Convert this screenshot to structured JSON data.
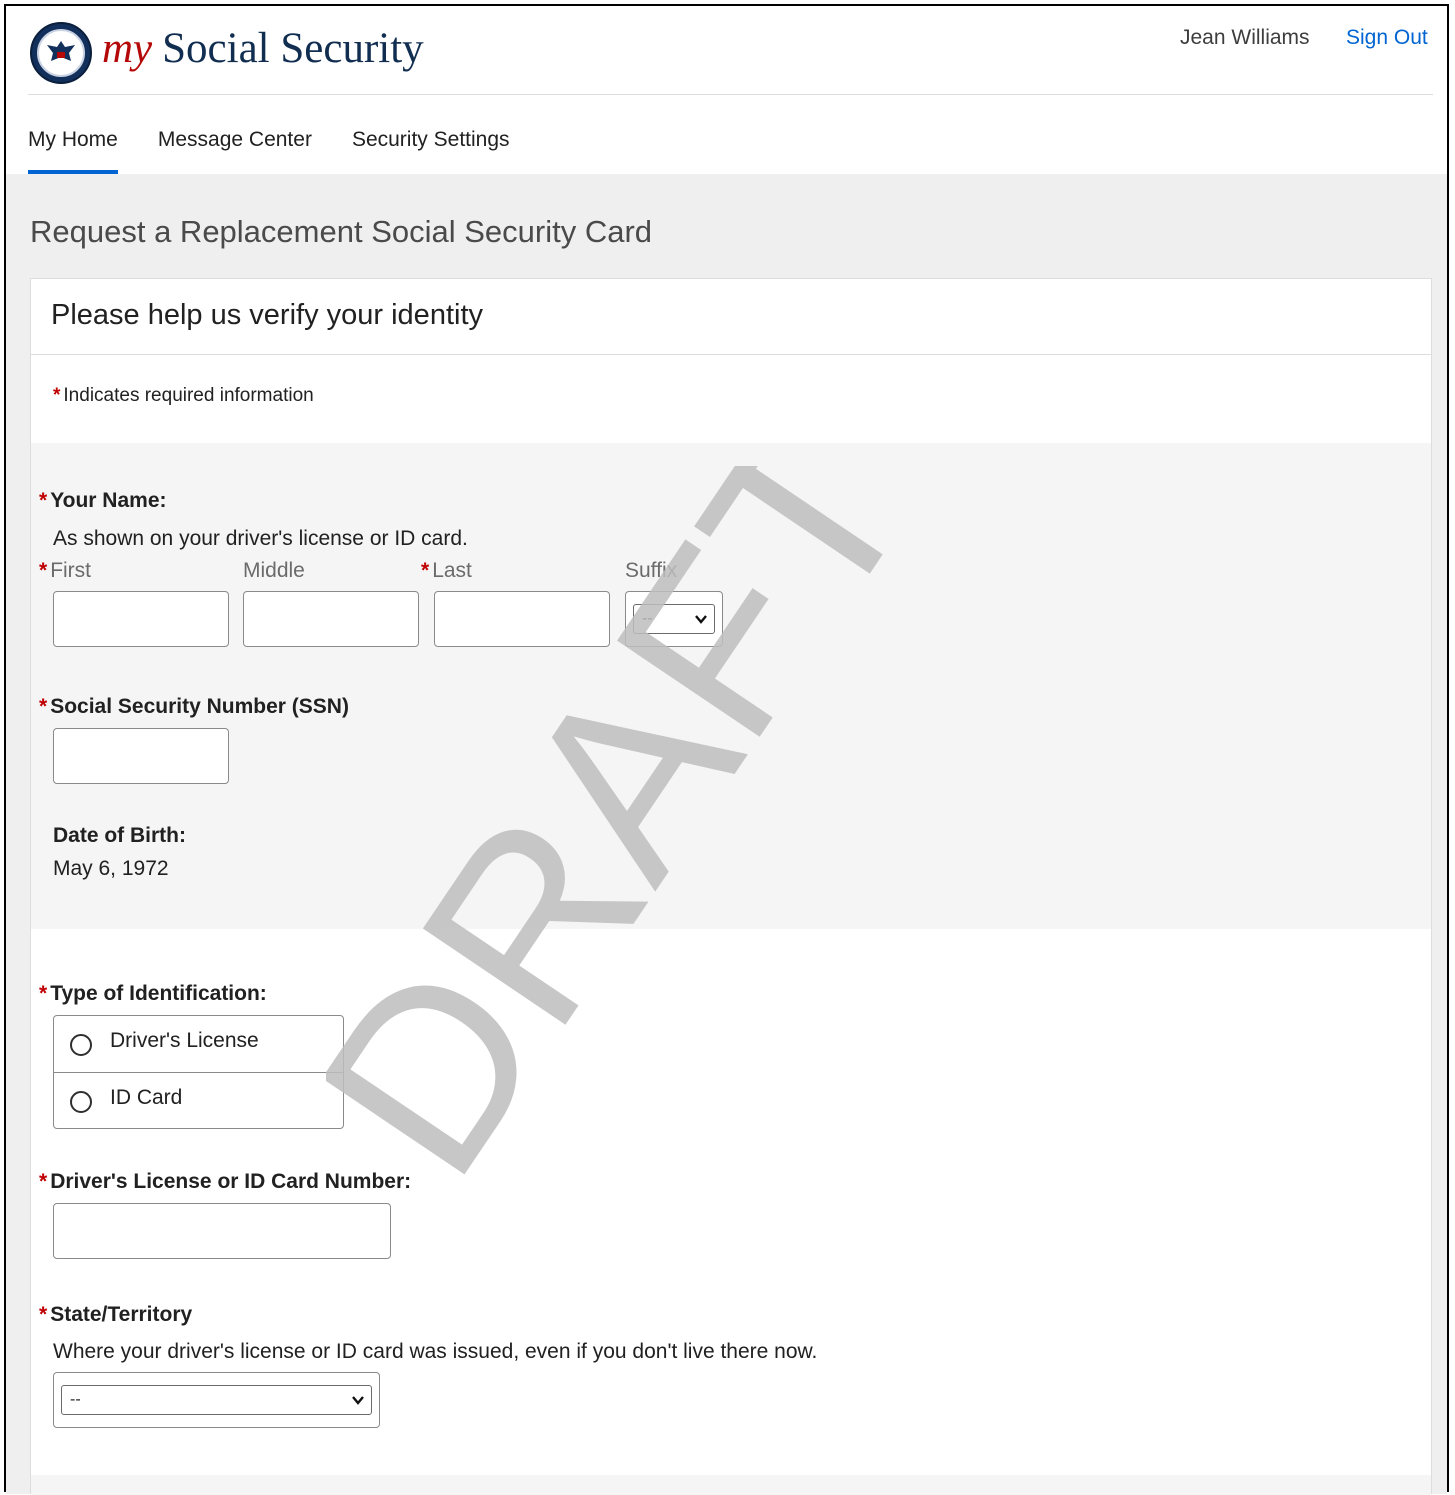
{
  "header": {
    "brand_my": "my",
    "brand_name": "Social Security",
    "logo_icon": "ssa-seal-icon",
    "user_name": "Jean Williams",
    "sign_out": "Sign Out"
  },
  "nav": {
    "items": [
      {
        "label": "My Home",
        "active": true
      },
      {
        "label": "Message Center",
        "active": false
      },
      {
        "label": "Security Settings",
        "active": false
      }
    ],
    "active_color": "#0064d2"
  },
  "page": {
    "title": "Request a Replacement Social Security Card"
  },
  "card": {
    "title": "Please help us verify your identity",
    "required_star": "*",
    "required_note": "Indicates required information"
  },
  "form": {
    "name": {
      "label": "Your Name:",
      "hint": "As shown on your driver's license or ID card.",
      "first_label": "First",
      "middle_label": "Middle",
      "last_label": "Last",
      "suffix_label": "Suffix",
      "suffix_value": "--",
      "first_value": "",
      "middle_value": "",
      "last_value": ""
    },
    "ssn": {
      "label": "Social Security Number (SSN)",
      "value": ""
    },
    "dob": {
      "label": "Date of Birth:",
      "value": "May 6, 1972"
    },
    "id_type": {
      "label": "Type of Identification:",
      "options": [
        "Driver's License",
        "ID Card"
      ],
      "selected": null
    },
    "id_number": {
      "label": "Driver's License or ID Card Number:",
      "value": ""
    },
    "state": {
      "label": "State/Territory",
      "hint": "Where your driver's license or ID card was issued, even if you don't live there now.",
      "value": "--"
    }
  },
  "watermark": {
    "text": "DRAFT",
    "color": "#bdbdbd"
  },
  "colors": {
    "required_star": "#c00000",
    "link": "#0064d2",
    "brand_my": "#b50909",
    "brand_name": "#112e51",
    "section_grey": "#f5f5f5"
  }
}
